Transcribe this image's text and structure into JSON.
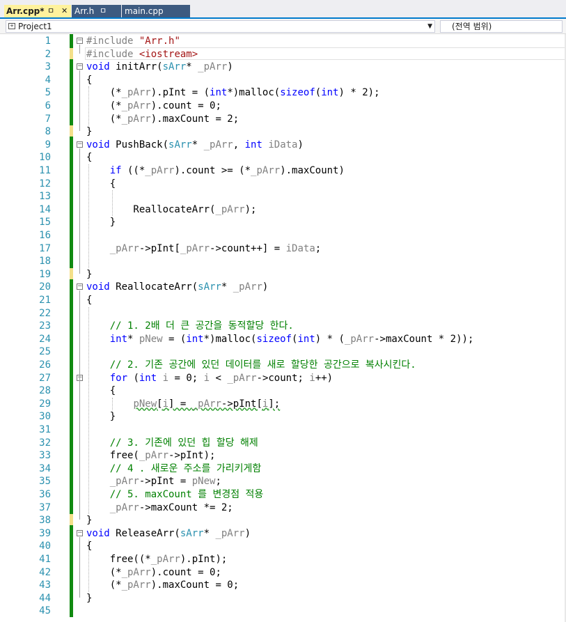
{
  "tabs": [
    {
      "label": "Arr.cpp*",
      "active": true
    },
    {
      "label": "Arr.h",
      "active": false
    },
    {
      "label": "main.cpp",
      "active": false
    }
  ],
  "tab_pin": "ㅁ",
  "tab_pin2": "ㅁ",
  "tab_close": "✕",
  "navbar": {
    "project": "Project1",
    "scope": "(전역 범위)"
  },
  "colors": {
    "keyword": "#0000ff",
    "string": "#a31515",
    "type": "#2b91af",
    "comment": "#008000",
    "line_number": "#2b91af",
    "change_margin": "#118a11"
  },
  "code": [
    "#include \"Arr.h\"",
    "#include <iostream>",
    "void initArr(sArr* _pArr)",
    "{",
    "    (*_pArr).pInt = (int*)malloc(sizeof(int) * 2);",
    "    (*_pArr).count = 0;",
    "    (*_pArr).maxCount = 2;",
    "}",
    "void PushBack(sArr* _pArr, int iData)",
    "{",
    "    if ((*_pArr).count >= (*_pArr).maxCount)",
    "    {",
    "",
    "        ReallocateArr(_pArr);",
    "    }",
    "",
    "    _pArr->pInt[_pArr->count++] = iData;",
    "",
    "}",
    "void ReallocateArr(sArr* _pArr)",
    "{",
    "",
    "    // 1. 2배 더 큰 공간을 동적할당 한다.",
    "    int* pNew = (int*)malloc(sizeof(int) * (_pArr->maxCount * 2));",
    "",
    "    // 2. 기존 공간에 있던 데이터를 새로 할당한 공간으로 복사시킨다.",
    "    for (int i = 0; i < _pArr->count; i++)",
    "    {",
    "        pNew[i] = _pArr->pInt[i];",
    "    }",
    "",
    "    // 3. 기존에 있던 힙 할당 해제",
    "    free(_pArr->pInt);",
    "    // 4 . 새로운 주소를 가리키게함",
    "    _pArr->pInt = pNew;",
    "    // 5. maxCount 를 변경점 적용",
    "    _pArr->maxCount *= 2;",
    "}",
    "void ReleaseArr(sArr* _pArr)",
    "{",
    "    free((*_pArr).pInt);",
    "    (*_pArr).count = 0;",
    "    (*_pArr).maxCount = 0;",
    "}",
    ""
  ]
}
